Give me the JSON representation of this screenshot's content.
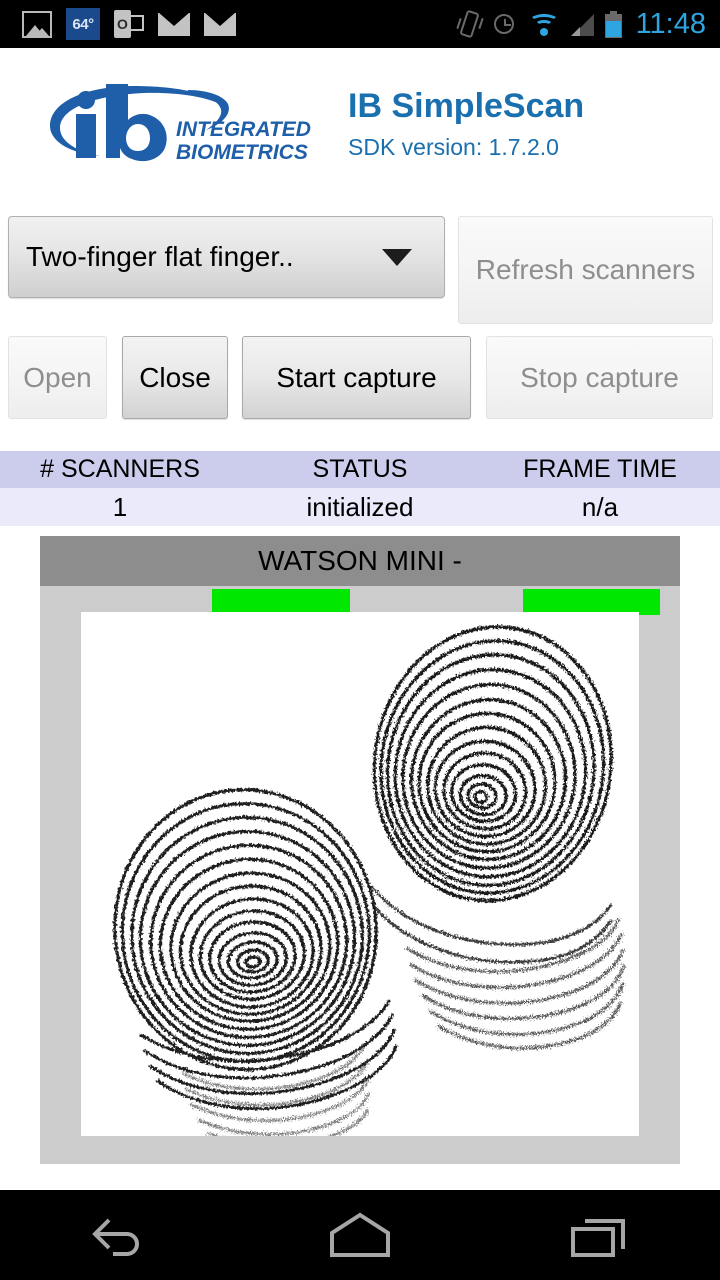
{
  "statusbar": {
    "weather_temp": "64°",
    "outlook_letter": "O",
    "clock": "11:48",
    "icons": [
      "gallery-icon",
      "weather-badge-icon",
      "outlook-icon",
      "mail-icon",
      "mail-icon",
      "vibrate-icon",
      "alarm-icon",
      "wifi-icon",
      "signal-icon",
      "battery-icon"
    ]
  },
  "header": {
    "logo_mark": "ib",
    "logo_line1": "INTEGRATED",
    "logo_line2": "BIOMETRICS",
    "app_title": "IB SimpleScan",
    "sdk_version": "SDK version: 1.7.2.0",
    "brand_color": "#1a6faf"
  },
  "controls": {
    "spinner_value": "Two-finger flat finger..",
    "refresh_label": "Refresh scanners",
    "open_label": "Open",
    "close_label": "Close",
    "start_label": "Start capture",
    "stop_label": "Stop capture"
  },
  "status_table": {
    "headers": [
      "# SCANNERS",
      "STATUS",
      "FRAME TIME"
    ],
    "values": [
      "1",
      "initialized",
      "n/a"
    ],
    "header_bg": "#ccccec",
    "row_bg": "#eaeafa"
  },
  "scanner": {
    "device_title": "WATSON MINI -",
    "indicator_color": "#00e800",
    "indicators": [
      "finger-indicator-left",
      "finger-indicator-right"
    ],
    "capture_alt": "two-finger flat fingerprint capture"
  },
  "navbar": {
    "back_label": "Back",
    "home_label": "Home",
    "recents_label": "Recent apps"
  }
}
